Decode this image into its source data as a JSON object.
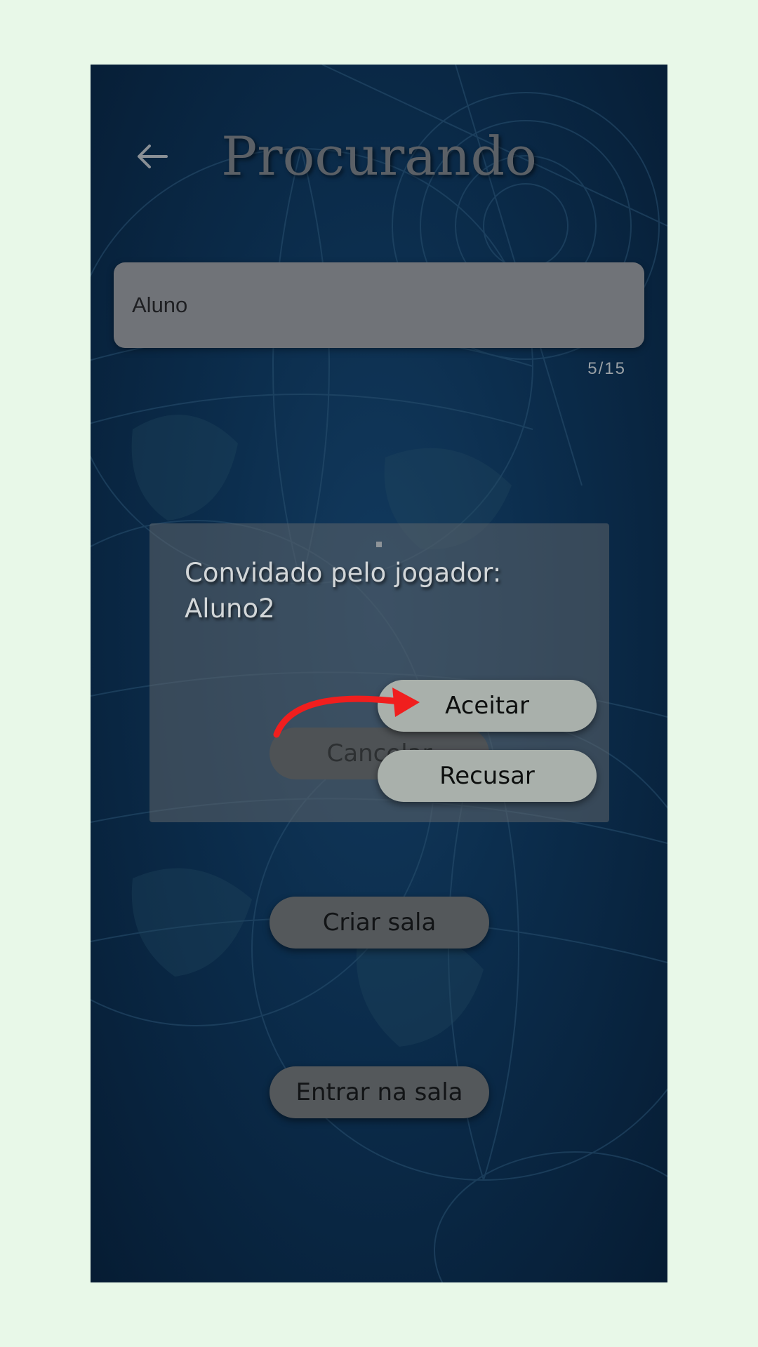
{
  "header": {
    "title": "Procurando"
  },
  "name_input": {
    "value": "Aluno",
    "counter": "5/15"
  },
  "invite_dialog": {
    "message": "Convidado pelo jogador:\nAluno2",
    "accept_label": "Aceitar",
    "decline_label": "Recusar",
    "cancel_label": "Cancelar"
  },
  "actions": {
    "create_room_label": "Criar sala",
    "join_room_label": "Entrar na sala"
  },
  "colors": {
    "outer_background": "#e8f8e8",
    "screen_background": "#0b2c4b",
    "title": "#5b6066",
    "highlight_arrow": "#f01e1e",
    "primary_pill": "#a9b0ab",
    "dimmed_pill": "#54585b"
  },
  "icons": {
    "back": "arrow-left-icon",
    "highlight": "curved-arrow-icon"
  }
}
